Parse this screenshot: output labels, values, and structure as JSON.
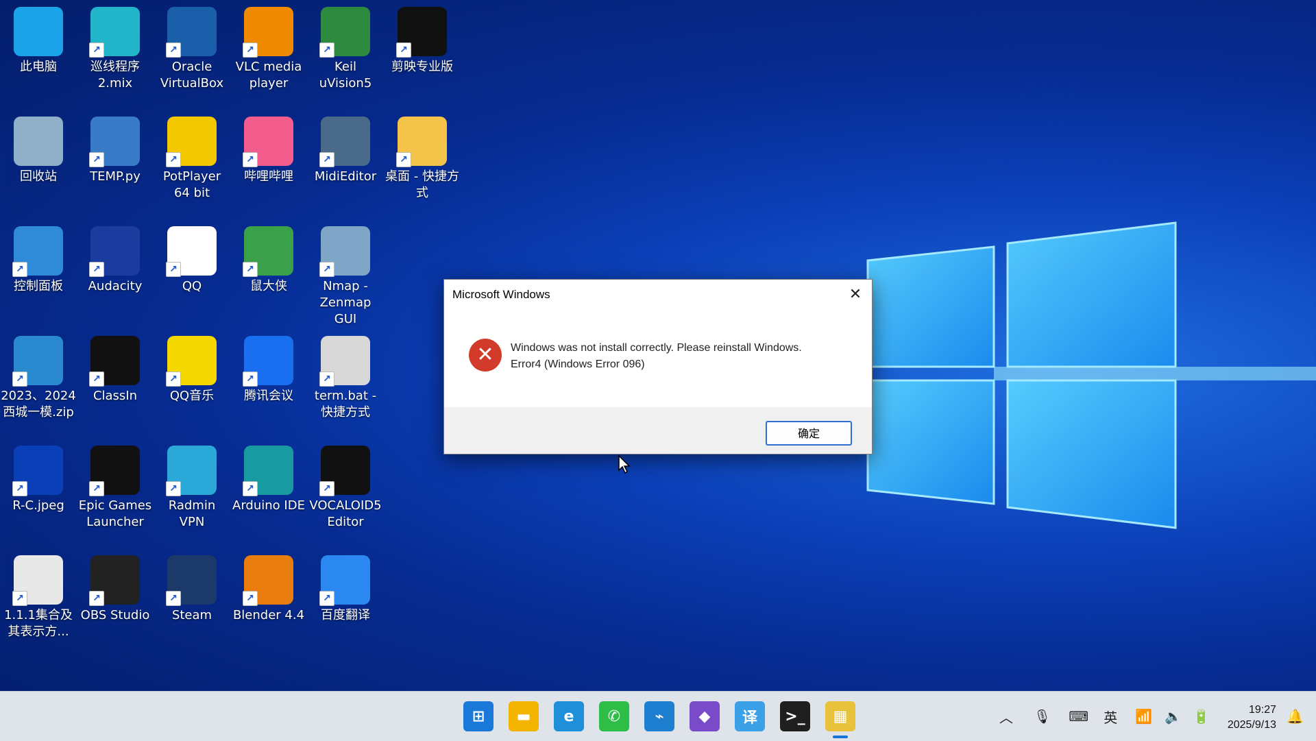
{
  "desktop": {
    "icons": [
      {
        "label": "此电脑",
        "icon": "computer-icon",
        "color": "#1aa3e8"
      },
      {
        "label": "巡线程序\n2.mix",
        "icon": "mix-icon",
        "color": "#22b4c8"
      },
      {
        "label": "Oracle\nVirtualBox",
        "icon": "virtualbox-icon",
        "color": "#1b5faa"
      },
      {
        "label": "VLC media\nplayer",
        "icon": "vlc-icon",
        "color": "#f08a00"
      },
      {
        "label": "Keil\nuVision5",
        "icon": "keil-icon",
        "color": "#2d8a3e"
      },
      {
        "label": "剪映专业版",
        "icon": "capcut-icon",
        "color": "#111111"
      },
      {
        "label": "回收站",
        "icon": "recycle-bin-icon",
        "color": "#8fb0c8"
      },
      {
        "label": "TEMP.py",
        "icon": "python-file-icon",
        "color": "#3a7bc8"
      },
      {
        "label": "PotPlayer\n64 bit",
        "icon": "potplayer-icon",
        "color": "#f3c800"
      },
      {
        "label": "哔哩哔哩",
        "icon": "bilibili-icon",
        "color": "#f25d8e"
      },
      {
        "label": "MidiEditor",
        "icon": "midieditor-icon",
        "color": "#4a6a8a"
      },
      {
        "label": "桌面 - 快捷方\n式",
        "icon": "folder-icon",
        "color": "#f3c34a"
      },
      {
        "label": "控制面板",
        "icon": "control-panel-icon",
        "color": "#2f8ad8"
      },
      {
        "label": "Audacity",
        "icon": "audacity-icon",
        "color": "#1b3c9e"
      },
      {
        "label": "QQ",
        "icon": "qq-icon",
        "color": "#ffffff"
      },
      {
        "label": "鼠大侠",
        "icon": "mouse-hero-icon",
        "color": "#3aa04a"
      },
      {
        "label": "Nmap -\nZenmap GUI",
        "icon": "nmap-icon",
        "color": "#7fa6c6"
      },
      {
        "label": "2023、2024\n西城一模.zip",
        "icon": "zip-icon",
        "color": "#2a8ad0"
      },
      {
        "label": "ClassIn",
        "icon": "classin-icon",
        "color": "#111111"
      },
      {
        "label": "QQ音乐",
        "icon": "qqmusic-icon",
        "color": "#f5d800"
      },
      {
        "label": "腾讯会议",
        "icon": "tencent-meeting-icon",
        "color": "#1a6ef0"
      },
      {
        "label": "term.bat -\n快捷方式",
        "icon": "bat-file-icon",
        "color": "#d8d8d8"
      },
      {
        "label": "R-C.jpeg",
        "icon": "image-file-icon",
        "color": "#0b3fb8"
      },
      {
        "label": "Epic Games\nLauncher",
        "icon": "epic-games-icon",
        "color": "#111111"
      },
      {
        "label": "Radmin\nVPN",
        "icon": "radmin-vpn-icon",
        "color": "#2aa8d8"
      },
      {
        "label": "Arduino IDE",
        "icon": "arduino-icon",
        "color": "#179aa0"
      },
      {
        "label": "VOCALOID5\nEditor",
        "icon": "vocaloid-icon",
        "color": "#111111"
      },
      {
        "label": "1.1.1集合及\n其表示方...",
        "icon": "pdf-icon",
        "color": "#e8e8e8"
      },
      {
        "label": "OBS Studio",
        "icon": "obs-icon",
        "color": "#222222"
      },
      {
        "label": "Steam",
        "icon": "steam-icon",
        "color": "#1b3a6a"
      },
      {
        "label": "Blender 4.4",
        "icon": "blender-icon",
        "color": "#e87d0d"
      },
      {
        "label": "百度翻译",
        "icon": "baidu-translate-icon",
        "color": "#2a88f0"
      }
    ]
  },
  "dialog": {
    "title": "Microsoft Windows",
    "message_line1": "Windows was not install correctly. Please reinstall Windows.",
    "message_line2": "Error4 (Windows Error 096)",
    "ok_label": "确定"
  },
  "taskbar": {
    "apps": [
      {
        "name": "start",
        "icon": "windows-start-icon"
      },
      {
        "name": "file-explorer",
        "icon": "folder-icon"
      },
      {
        "name": "edge",
        "icon": "edge-icon"
      },
      {
        "name": "wechat",
        "icon": "wechat-icon"
      },
      {
        "name": "vscode",
        "icon": "vscode-icon"
      },
      {
        "name": "visual-studio",
        "icon": "visual-studio-icon"
      },
      {
        "name": "translate",
        "icon": "translate-icon"
      },
      {
        "name": "terminal",
        "icon": "terminal-icon"
      },
      {
        "name": "active-app",
        "icon": "app-window-icon"
      }
    ],
    "ime_label": "英",
    "time": "19:27",
    "date": "2025/9/13"
  }
}
